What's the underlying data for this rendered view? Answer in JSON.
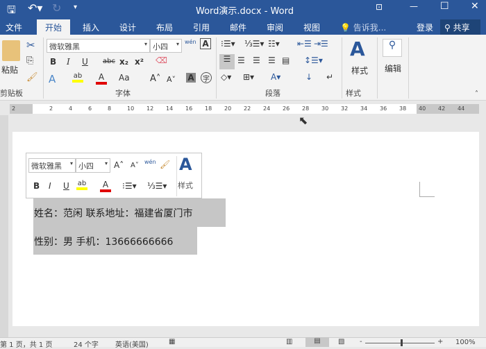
{
  "title": "Word演示.docx - Word",
  "qat": {
    "save": "save-icon",
    "undo": "undo-icon",
    "redo": "redo-icon"
  },
  "tabs": [
    "文件",
    "开始",
    "插入",
    "设计",
    "布局",
    "引用",
    "邮件",
    "审阅",
    "视图"
  ],
  "tell_me": "告诉我...",
  "login": "登录",
  "share": "共享",
  "ribbon": {
    "clipboard": {
      "paste": "粘贴",
      "group": "剪贴板"
    },
    "font": {
      "name": "微软雅黑",
      "size": "小四",
      "group": "字体",
      "bold": "B",
      "italic": "I",
      "underline": "U",
      "strike": "abc",
      "sub": "x₂",
      "sup": "x²",
      "pinyin": "wén",
      "aa": "Aa"
    },
    "paragraph": {
      "group": "段落"
    },
    "styles": {
      "label": "样式",
      "group": "样式"
    },
    "editing": {
      "label": "编辑"
    }
  },
  "ruler": {
    "ticks": [
      "2",
      "2",
      "4",
      "6",
      "8",
      "10",
      "12",
      "14",
      "16",
      "18",
      "20",
      "22",
      "24",
      "26",
      "28",
      "30",
      "32",
      "34",
      "36",
      "38",
      "40",
      "42",
      "44"
    ]
  },
  "mini_toolbar": {
    "font": "微软雅黑",
    "size": "小四",
    "styles": "样式"
  },
  "document": {
    "lines": [
      "姓名：范闲  联系地址：福建省厦门市",
      "性别：男  手机：13666666666"
    ]
  },
  "status": {
    "page": "第 1 页，共 1 页",
    "words": "24 个字",
    "lang": "英语(美国)",
    "zoom": "100%"
  }
}
